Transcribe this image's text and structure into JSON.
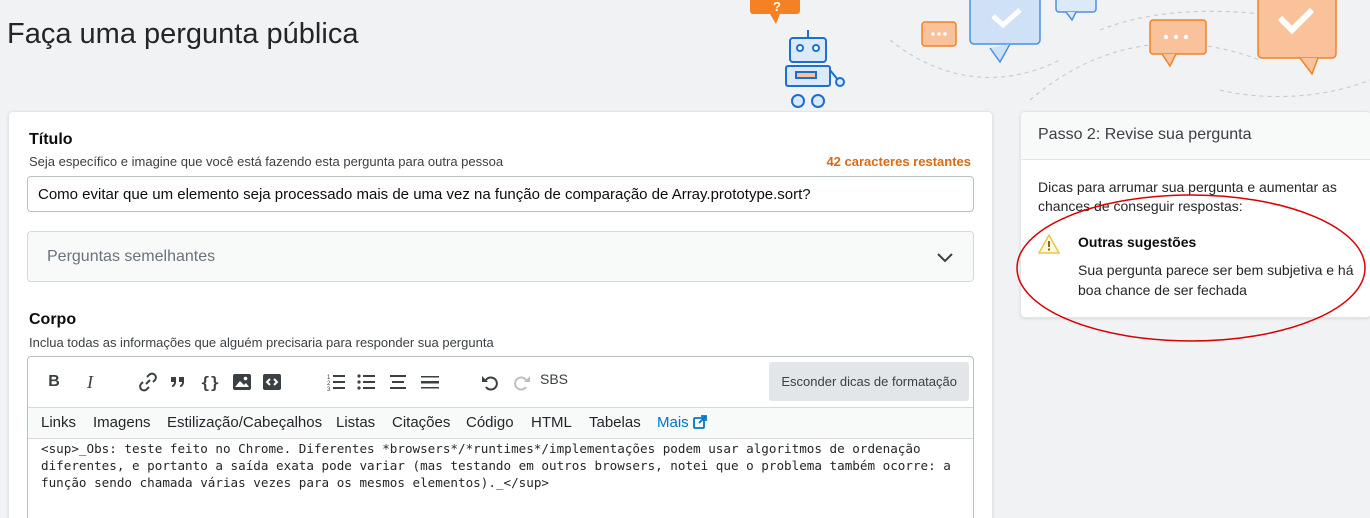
{
  "page": {
    "title": "Faça uma pergunta pública"
  },
  "title_section": {
    "label": "Título",
    "help": "Seja específico e imagine que você está fazendo esta pergunta para outra pessoa",
    "remaining": "42 caracteres restantes",
    "value": "Como evitar que um elemento seja processado mais de uma vez na função de comparação de Array.prototype.sort?"
  },
  "similar": {
    "label": "Perguntas semelhantes",
    "icon": "chevron-down-icon"
  },
  "body_section": {
    "label": "Corpo",
    "help": "Inclua todas as informações que alguém precisaria para responder sua pergunta"
  },
  "toolbar": {
    "buttons": [
      "bold",
      "italic",
      "link",
      "blockquote",
      "code",
      "image",
      "snippet",
      "ordered-list",
      "unordered-list",
      "heading",
      "horizontal-rule",
      "undo",
      "redo"
    ],
    "sbs_label": "SBS",
    "hide_tips_label": "Esconder dicas de formatação"
  },
  "tips": {
    "links": [
      "Links",
      "Imagens",
      "Estilização/Cabeçalhos",
      "Listas",
      "Citações",
      "Código",
      "HTML",
      "Tabelas"
    ],
    "more": "Mais"
  },
  "editor": {
    "content": "<sup>_Obs: teste feito no Chrome. Diferentes *browsers*/*runtimes*/implementações podem usar algoritmos de ordenação diferentes, e portanto a saída exata pode variar (mas testando em outros browsers, notei que o problema também ocorre: a função sendo chamada várias vezes para os mesmos elementos)._</sup>"
  },
  "side": {
    "header": "Passo 2: Revise sua pergunta",
    "intro": "Dicas para arrumar sua pergunta e aumentar as chances de conseguir respostas:",
    "other_title": "Outras sugestões",
    "other_body": "Sua pergunta parece ser bem subjetiva e há boa chance de ser fechada"
  },
  "colors": {
    "remaining": "#d86b15",
    "link": "#0074cc",
    "annotation": "#d80000",
    "warning": "#e8c647"
  }
}
